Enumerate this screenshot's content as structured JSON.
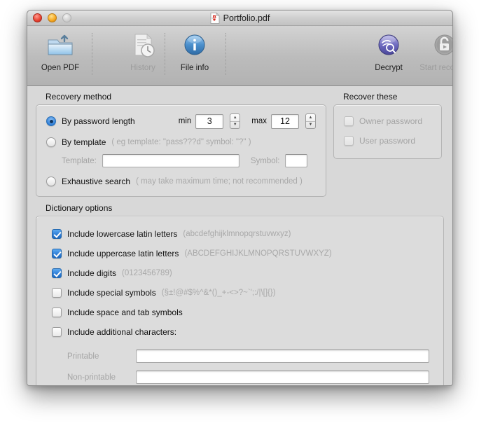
{
  "window": {
    "title": "Portfolio.pdf",
    "pdf_icon": "pdf-file-icon",
    "traffic_lights": [
      "close-button",
      "minimize-button",
      "zoom-button"
    ]
  },
  "toolbar": {
    "items": [
      {
        "label": "Open PDF",
        "icon": "open-folder-icon",
        "enabled": true
      },
      {
        "label": "History",
        "icon": "history-clock-icon",
        "enabled": false
      },
      {
        "label": "File info",
        "icon": "info-icon",
        "enabled": true
      },
      {
        "label": "Decrypt",
        "icon": "decrypt-eye-icon",
        "enabled": true
      },
      {
        "label": "Start recovery",
        "icon": "unlock-play-icon",
        "enabled": false
      }
    ]
  },
  "recovery_method": {
    "title": "Recovery method",
    "options": [
      {
        "label": "By password length",
        "selected": true
      },
      {
        "label": "By template",
        "selected": false,
        "hint": "( eg template: \"pass???d\" symbol: \"?\" )"
      },
      {
        "label": "Exhaustive search",
        "selected": false,
        "hint": "( may take maximum time; not recommended )"
      }
    ],
    "min_label": "min",
    "min_value": "3",
    "max_label": "max",
    "max_value": "12",
    "template_label": "Template:",
    "template_value": "",
    "symbol_label": "Symbol:",
    "symbol_value": ""
  },
  "recover_these": {
    "title": "Recover these",
    "items": [
      {
        "label": "Owner password",
        "checked": false,
        "enabled": false
      },
      {
        "label": "User password",
        "checked": false,
        "enabled": false
      }
    ]
  },
  "dictionary_options": {
    "title": "Dictionary options",
    "items": [
      {
        "label": "Include lowercase latin letters",
        "charset": "(abcdefghijklmnopqrstuvwxyz)",
        "checked": true
      },
      {
        "label": "Include uppercase latin letters",
        "charset": "(ABCDEFGHIJKLMNOPQRSTUVWXYZ)",
        "checked": true
      },
      {
        "label": "Include digits",
        "charset": "(0123456789)",
        "checked": true
      },
      {
        "label": "Include special symbols",
        "charset": "(§±!@#$%^&*()_+-<>?~`';:/|\\[]{})",
        "checked": false
      },
      {
        "label": "Include space and tab symbols",
        "charset": "",
        "checked": false
      },
      {
        "label": "Include additional characters:",
        "charset": "",
        "checked": false
      }
    ],
    "printable_label": "Printable",
    "printable_value": "",
    "nonprintable_label": "Non-printable",
    "nonprintable_value": ""
  },
  "colors": {
    "accent_blue": "#2f7fd8",
    "window_bg": "#d8d8d8",
    "disabled_text": "#a4a4a4"
  }
}
